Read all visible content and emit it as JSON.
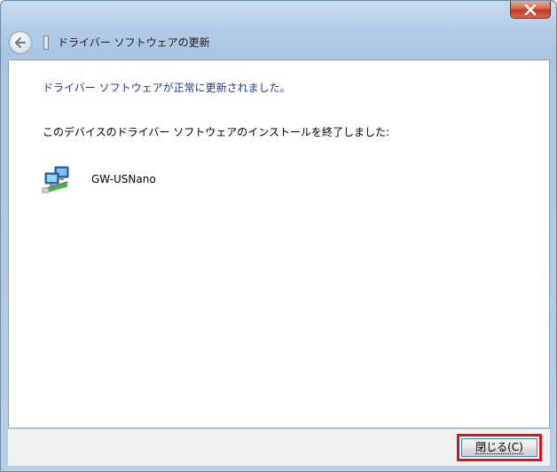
{
  "window": {
    "close_icon": "close-icon"
  },
  "header": {
    "title": "ドライバー ソフトウェアの更新",
    "back_icon": "back-arrow-icon",
    "device_icon": "device-icon"
  },
  "content": {
    "success_message": "ドライバー ソフトウェアが正常に更新されました。",
    "finish_message": "このデバイスのドライバー ソフトウェアのインストールを終了しました:",
    "device_name": "GW-USNano",
    "device_icon": "network-adapter-icon"
  },
  "footer": {
    "close_button_label": "閉じる(C)"
  },
  "colors": {
    "success_text": "#1f3a93",
    "highlight_border": "#e4101e",
    "close_button_red": "#c0392b"
  }
}
